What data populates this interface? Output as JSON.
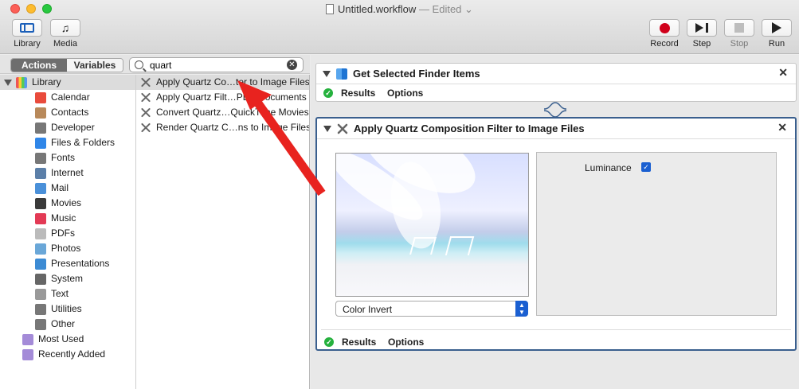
{
  "window": {
    "title": "Untitled.workflow",
    "status": "— Edited"
  },
  "toolbar": {
    "library": "Library",
    "media": "Media",
    "record": "Record",
    "step": "Step",
    "stop": "Stop",
    "run": "Run"
  },
  "library": {
    "tabs": {
      "actions": "Actions",
      "variables": "Variables"
    },
    "search": {
      "value": "quart"
    },
    "root": "Library",
    "categories": [
      {
        "label": "Calendar",
        "icon": "calendar-icon",
        "color": "#e94b3c"
      },
      {
        "label": "Contacts",
        "icon": "contacts-icon",
        "color": "#b8895a"
      },
      {
        "label": "Developer",
        "icon": "developer-icon",
        "color": "#777777"
      },
      {
        "label": "Files & Folders",
        "icon": "finder-icon",
        "color": "#2f86e8"
      },
      {
        "label": "Fonts",
        "icon": "fonts-icon",
        "color": "#777777"
      },
      {
        "label": "Internet",
        "icon": "globe-icon",
        "color": "#5b7fa8"
      },
      {
        "label": "Mail",
        "icon": "mail-icon",
        "color": "#4a90d9"
      },
      {
        "label": "Movies",
        "icon": "movies-icon",
        "color": "#3a3a3a"
      },
      {
        "label": "Music",
        "icon": "music-icon",
        "color": "#e33a55"
      },
      {
        "label": "PDFs",
        "icon": "pdf-icon",
        "color": "#bbbbbb"
      },
      {
        "label": "Photos",
        "icon": "photos-icon",
        "color": "#6aa7d8"
      },
      {
        "label": "Presentations",
        "icon": "presentation-icon",
        "color": "#3c8bd4"
      },
      {
        "label": "System",
        "icon": "system-icon",
        "color": "#666666"
      },
      {
        "label": "Text",
        "icon": "text-icon",
        "color": "#999999"
      },
      {
        "label": "Utilities",
        "icon": "utilities-icon",
        "color": "#777777"
      },
      {
        "label": "Other",
        "icon": "other-icon",
        "color": "#777777"
      }
    ],
    "smart": [
      {
        "label": "Most Used",
        "icon": "smart-folder-icon",
        "color": "#a48bd8"
      },
      {
        "label": "Recently Added",
        "icon": "smart-folder-icon",
        "color": "#a48bd8"
      }
    ],
    "results": [
      "Apply Quartz Co…ter to Image Files",
      "Apply Quartz Filt…PDF Documents",
      "Convert Quartz…QuickTime Movies",
      "Render Quartz C…ns to Image Files"
    ]
  },
  "workflow": {
    "actions": [
      {
        "title": "Get Selected Finder Items",
        "results": "Results",
        "options": "Options"
      },
      {
        "title": "Apply Quartz Composition Filter to Image Files",
        "results": "Results",
        "options": "Options",
        "filter": "Color Invert",
        "param_label": "Luminance",
        "param_checked": true
      }
    ]
  },
  "colors": {
    "accent": "#1a5fd1",
    "arrow": "#e8231f",
    "selected_border": "#3a5f8e"
  }
}
